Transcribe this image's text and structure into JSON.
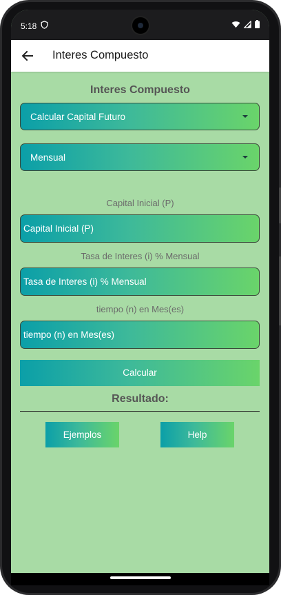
{
  "status": {
    "time": "5:18"
  },
  "appbar": {
    "title": "Interes Compuesto"
  },
  "main": {
    "heading": "Interes Compuesto",
    "calc_type": "Calcular Capital Futuro",
    "period": "Mensual",
    "capital_label": "Capital Inicial (P)",
    "capital_placeholder": "Capital Inicial (P)",
    "rate_label": "Tasa de Interes (i) % Mensual",
    "rate_placeholder": "Tasa de Interes (i) % Mensual",
    "time_label": "tiempo (n) en Mes(es)",
    "time_placeholder": "tiempo (n) en Mes(es)",
    "calc_button": "Calcular",
    "result_label": "Resultado:",
    "examples_button": "Ejemplos",
    "help_button": "Help"
  },
  "colors": {
    "background": "#a8dba5",
    "gradient_start": "#0b9fa8",
    "gradient_end": "#6ad46a"
  }
}
